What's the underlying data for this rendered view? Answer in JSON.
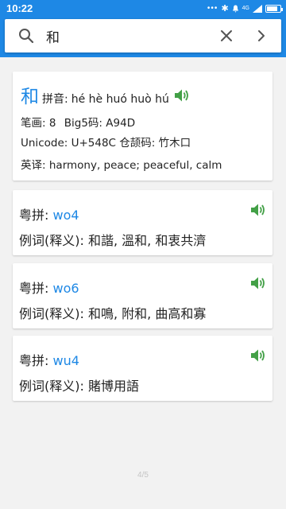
{
  "status": {
    "time": "10:22",
    "network": "4G"
  },
  "search": {
    "value": "和"
  },
  "entry": {
    "character": "和",
    "pinyin_label": "拼音:",
    "pinyin": "hé hè huó huò hú",
    "strokes_label": "笔画:",
    "strokes": "8",
    "big5_label": "Big5码:",
    "big5": "A94D",
    "unicode_label": "Unicode:",
    "unicode": "U+548C",
    "cangjie_label": "仓颉码:",
    "cangjie": "竹木口",
    "english_label": "英译:",
    "english": "harmony, peace; peaceful, calm"
  },
  "pronunciations": [
    {
      "label": "粤拼:",
      "jyutping": "wo4",
      "examples_label": "例词(释义):",
      "examples": "和諧, 溫和, 和衷共濟"
    },
    {
      "label": "粤拼:",
      "jyutping": "wo6",
      "examples_label": "例词(释义):",
      "examples": "和鳴, 附和, 曲高和寡"
    },
    {
      "label": "粤拼:",
      "jyutping": "wu4",
      "examples_label": "例词(释义):",
      "examples": "賭博用語"
    }
  ],
  "pager": "4/5",
  "colors": {
    "primary": "#1e88e5",
    "speaker": "#43a047"
  },
  "icons": [
    "search-icon",
    "clear-icon",
    "chevron-right-icon",
    "speaker-icon"
  ]
}
